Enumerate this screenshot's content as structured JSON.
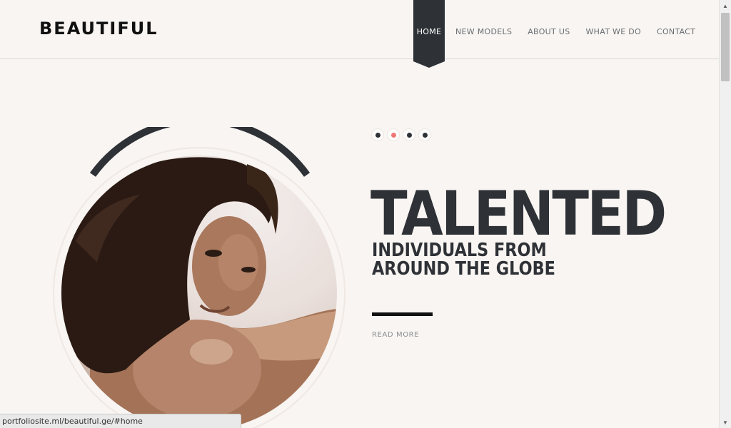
{
  "header": {
    "logo": "BEAUTIFUL",
    "nav": [
      {
        "label": "HOME",
        "active": true
      },
      {
        "label": "NEW MODELS",
        "active": false
      },
      {
        "label": "ABOUT US",
        "active": false
      },
      {
        "label": "WHAT WE DO",
        "active": false
      },
      {
        "label": "CONTACT",
        "active": false
      }
    ]
  },
  "slider": {
    "dot_count": 4,
    "active_index": 2
  },
  "hero": {
    "headline": "TALENTED",
    "subheadline": "INDIVIDUALS FROM AROUND THE GLOBE",
    "read_more": "READ MORE"
  },
  "status_bar": {
    "url": "portfoliosite.ml/beautiful.ge/#home"
  },
  "colors": {
    "background": "#f8f5f2",
    "dark": "#2e3136",
    "accent": "#f07575"
  }
}
